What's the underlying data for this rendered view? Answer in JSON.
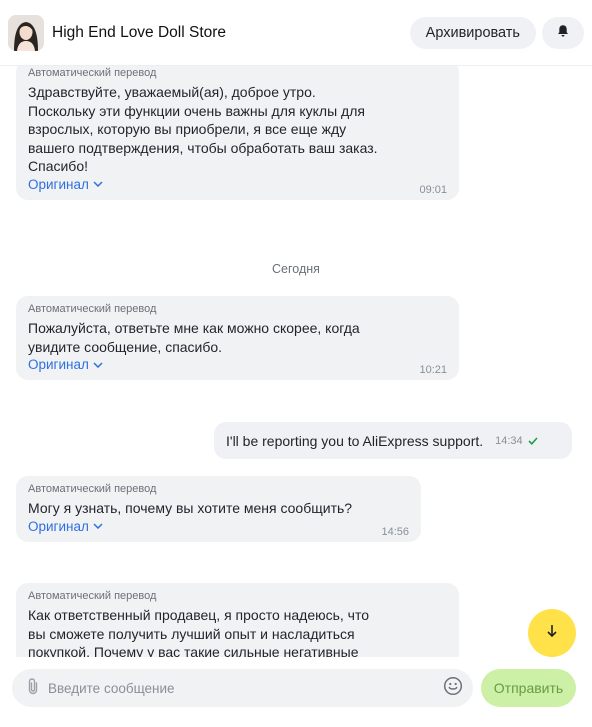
{
  "header": {
    "store_name": "High End Love Doll Store",
    "archive_label": "Архивировать",
    "bell_icon": "bell-icon"
  },
  "messages": [
    {
      "direction": "in",
      "translation_label": "Автоматический перевод",
      "text": "Здравствуйте, уважаемый(ая), доброе утро.\nПоскольку эти функции очень важны для куклы для\nвзрослых, которую вы приобрели, я все еще жду\nвашего подтверждения, чтобы обработать ваш заказ.\nСпасибо!",
      "original_label": "Оригинал",
      "time": "09:01"
    },
    {
      "direction": "separator",
      "label": "Сегодня"
    },
    {
      "direction": "in",
      "translation_label": "Автоматический перевод",
      "text": "Пожалуйста, ответьте мне как можно скорее, когда\nувидите сообщение, спасибо.",
      "original_label": "Оригинал",
      "time": "10:21"
    },
    {
      "direction": "out",
      "text": "I'll be reporting you to AliExpress support.",
      "time": "14:34",
      "status": "read"
    },
    {
      "direction": "in",
      "translation_label": "Автоматический перевод",
      "text": "Могу я узнать, почему вы хотите меня сообщить?",
      "original_label": "Оригинал",
      "time": "14:56"
    },
    {
      "direction": "in",
      "translation_label": "Автоматический перевод",
      "text": "Как ответственный продавец, я просто надеюсь, что\nвы сможете получить лучший опыт и насладиться\nпокупкой. Почему у вас такие сильные негативные"
    }
  ],
  "composer": {
    "placeholder": "Введите сообщение",
    "send_label": "Отправить"
  },
  "colors": {
    "accent_yellow": "#ffe14a",
    "send_disabled": "#ccf0a6",
    "link_blue": "#2f6fe0",
    "read_check": "#1e9e4a"
  }
}
